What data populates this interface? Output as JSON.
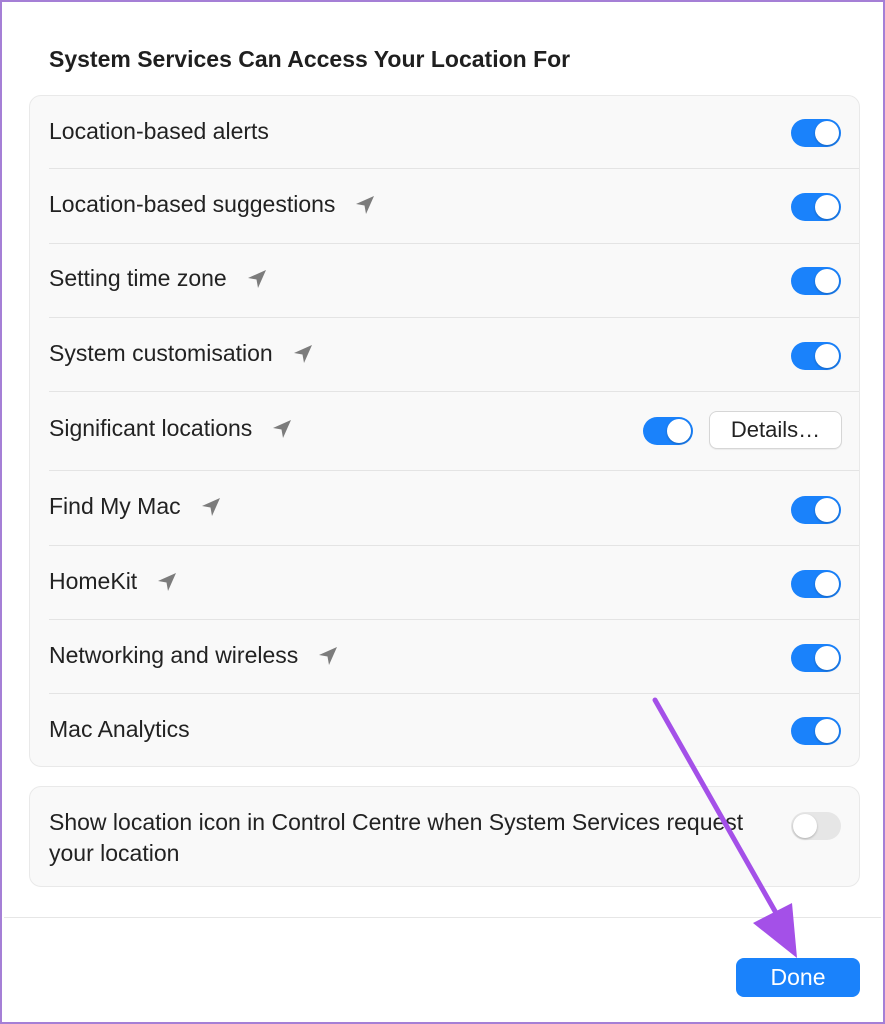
{
  "section_title": "System Services Can Access Your Location For",
  "services": [
    {
      "label": "Location-based alerts",
      "location_icon": false,
      "enabled": true
    },
    {
      "label": "Location-based suggestions",
      "location_icon": true,
      "enabled": true
    },
    {
      "label": "Setting time zone",
      "location_icon": true,
      "enabled": true
    },
    {
      "label": "System customisation",
      "location_icon": true,
      "enabled": true
    },
    {
      "label": "Significant locations",
      "location_icon": true,
      "enabled": true,
      "button": "Details…"
    },
    {
      "label": "Find My Mac",
      "location_icon": true,
      "enabled": true
    },
    {
      "label": "HomeKit",
      "location_icon": true,
      "enabled": true
    },
    {
      "label": "Networking and wireless",
      "location_icon": true,
      "enabled": true
    },
    {
      "label": "Mac Analytics",
      "location_icon": false,
      "enabled": true
    }
  ],
  "control_centre": {
    "label": "Show location icon in Control Centre when System Services request your location",
    "enabled": false
  },
  "done_label": "Done",
  "colors": {
    "accent": "#1a82fb",
    "annotation_arrow": "#a450e8",
    "frame_border": "#a57fd6"
  },
  "icons": {
    "location": "location-arrow-icon"
  }
}
